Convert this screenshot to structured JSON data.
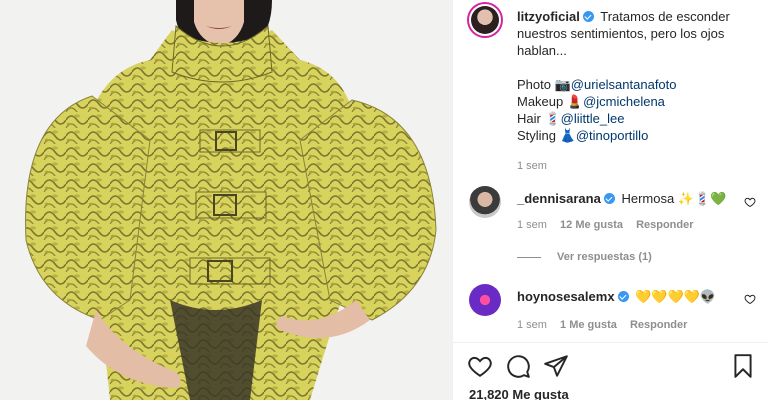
{
  "post": {
    "author": "litzyoficial",
    "caption_line1": "Tratamos de esconder nuestros sentimientos, pero los ojos hablan...",
    "credits": [
      {
        "label": "Photo",
        "emoji": "📷",
        "mention": "@urielsantanafoto"
      },
      {
        "label": "Makeup",
        "emoji": "💄",
        "mention": "@jcmichelena"
      },
      {
        "label": "Hair",
        "emoji": "💈",
        "mention": "@liittle_lee"
      },
      {
        "label": "Styling",
        "emoji": "👗",
        "mention": "@tinoportillo"
      }
    ],
    "age": "1 sem"
  },
  "comments": [
    {
      "user": "_dennisarana",
      "text": "Hermosa ✨💈💚",
      "age": "1 sem",
      "likes": "12 Me gusta",
      "reply": "Responder",
      "view_replies": "Ver respuestas (1)"
    },
    {
      "user": "hoynosesalemx",
      "text": "💛💛💛💛👽",
      "age": "1 sem",
      "likes": "1 Me gusta",
      "reply": "Responder"
    }
  ],
  "likes_count": "21,820 Me gusta",
  "icons": {
    "like": "heart-icon",
    "comment": "comment-icon",
    "share": "paper-plane-icon",
    "save": "bookmark-icon",
    "verified": "verified-badge-icon"
  },
  "colors": {
    "verified": "#3897f0",
    "mention": "#00376b",
    "muted": "#8e8e8e",
    "coat": "#d9d35a"
  }
}
